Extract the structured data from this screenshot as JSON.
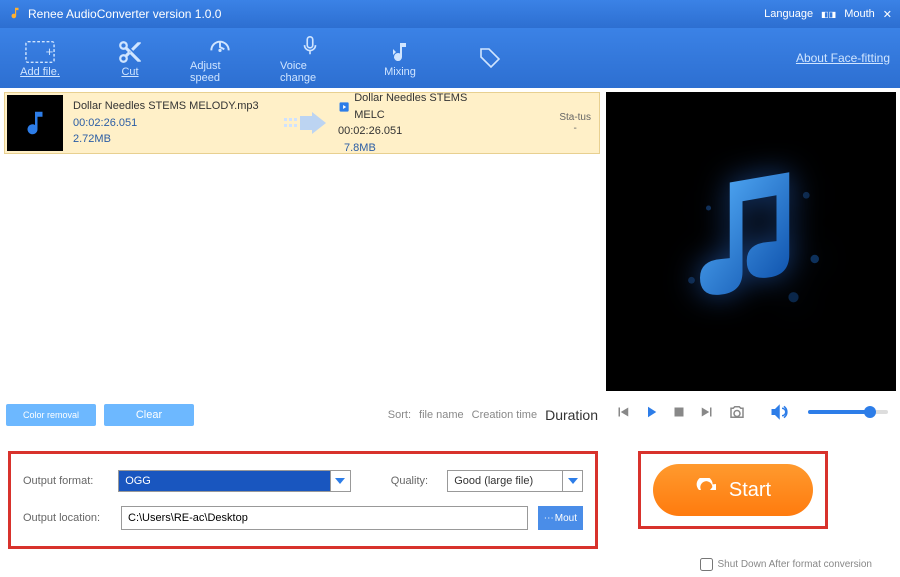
{
  "header": {
    "title": "Renee AudioConverter version 1.0.0",
    "language": "Language",
    "mouth": "Mouth"
  },
  "toolbar": {
    "add_file": "Add file.",
    "cut": "Cut",
    "adjust_speed": "Adjust speed",
    "voice_change": "Voice change",
    "mixing": "Mixing",
    "image": "",
    "about": "About Face-fitting"
  },
  "file": {
    "source_name": "Dollar Needles STEMS MELODY.mp3",
    "source_duration": "00:02:26.051",
    "source_size": "2.72MB",
    "target_name": "Dollar Needles STEMS MELC",
    "target_duration": "00:02:26.051",
    "target_size": "7.8MB",
    "status_label": "Sta-tus",
    "status_val": "-"
  },
  "buttons": {
    "color_removal": "Color removal",
    "clear": "Clear"
  },
  "sort": {
    "label": "Sort:",
    "file_name": "file name",
    "creation_time": "Creation time",
    "duration": "Duration"
  },
  "output": {
    "format_label": "Output format:",
    "format_value": "OGG",
    "quality_label": "Quality:",
    "quality_value": "Good (large file)",
    "location_label": "Output location:",
    "location_value": "C:\\Users\\RE-ac\\Desktop",
    "browse": "Mout",
    "start": "Start",
    "shutdown": "Shut Down After format conversion"
  }
}
